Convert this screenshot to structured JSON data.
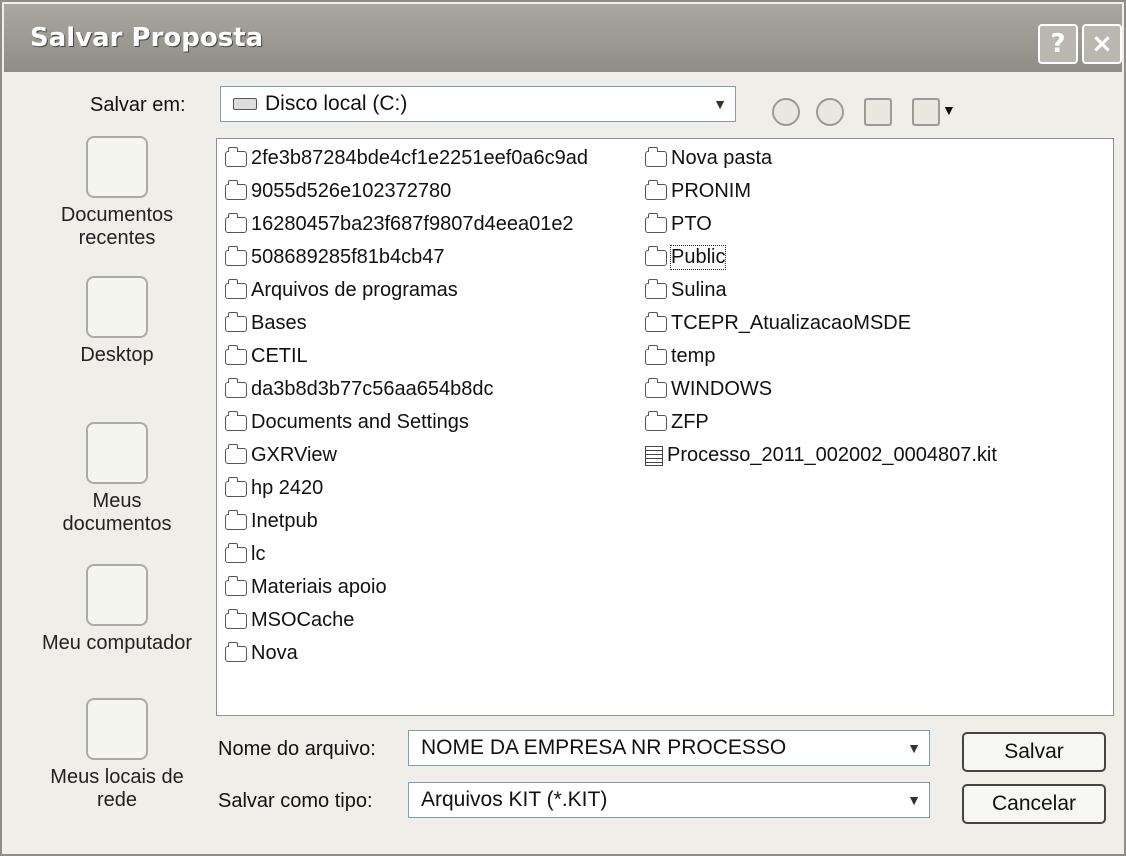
{
  "window": {
    "title": "Salvar Proposta",
    "help_glyph": "?",
    "close_glyph": "×"
  },
  "save_in": {
    "label": "Salvar em:",
    "value": "Disco local (C:)"
  },
  "places": [
    {
      "label_line1": "Documentos",
      "label_line2": "recentes"
    },
    {
      "label_line1": "Desktop",
      "label_line2": ""
    },
    {
      "label_line1": "Meus",
      "label_line2": "documentos"
    },
    {
      "label_line1": "Meu computador",
      "label_line2": ""
    },
    {
      "label_line1": "Meus locais de",
      "label_line2": "rede"
    }
  ],
  "files": {
    "column1": [
      "2fe3b87284bde4cf1e2251eef0a6c9ad",
      "9055d526e102372780",
      "16280457ba23f687f9807d4eea01e2",
      "508689285f81b4cb47",
      "Arquivos de programas",
      "Bases",
      "CETIL",
      "da3b8d3b77c56aa654b8dc",
      "Documents and Settings",
      "GXRView",
      "hp 2420",
      "Inetpub",
      "lc",
      "Materiais apoio",
      "MSOCache",
      "Nova"
    ],
    "column2": [
      "Nova pasta",
      "PRONIM",
      "PTO",
      "Public",
      "Sulina",
      "TCEPR_AtualizacaoMSDE",
      "temp",
      "WINDOWS",
      "ZFP",
      "Processo_2011_002002_0004807.kit"
    ]
  },
  "filename": {
    "label": "Nome do arquivo:",
    "value": "NOME DA EMPRESA NR PROCESSO"
  },
  "filetype": {
    "label": "Salvar como tipo:",
    "value": "Arquivos KIT (*.KIT)"
  },
  "buttons": {
    "save": "Salvar",
    "cancel": "Cancelar"
  }
}
